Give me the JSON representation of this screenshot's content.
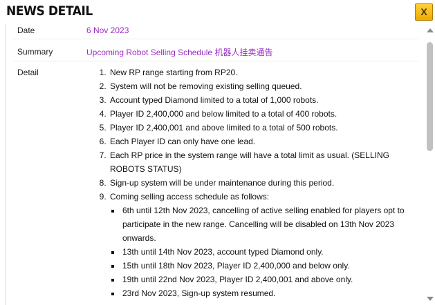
{
  "dialog": {
    "title": "NEWS DETAIL",
    "close_label": "X"
  },
  "fields": {
    "date_label": "Date",
    "date_value": "6 Nov 2023",
    "summary_label": "Summary",
    "summary_value": "Upcoming Robot Selling Schedule 机器人挂卖通告",
    "detail_label": "Detail"
  },
  "detail_items": [
    "New RP range starting from RP20.",
    "System will not be removing existing selling queued.",
    "Account typed Diamond limited to a total of 1,000 robots.",
    "Player ID 2,400,000 and below limited to a total of 400 robots.",
    "Player ID 2,400,001 and above limited to a total of 500 robots.",
    "Each Player ID can only have one lead.",
    "Each RP price in the system range will have a total limit as usual. (SELLING ROBOTS STATUS)",
    "Sign-up system will be under maintenance during this period.",
    "Coming selling access schedule as follows:"
  ],
  "schedule_items": [
    "6th until 12th Nov 2023, cancelling of active selling enabled for players opt to participate in the new range. Cancelling will be disabled on 13th Nov 2023 onwards.",
    "13th until 14th Nov 2023, account typed Diamond only.",
    "15th until 18th Nov 2023, Player ID 2,400,000 and below only.",
    "19th until 22nd Nov 2023, Player ID 2,400,001 and above only.",
    "23rd Nov 2023, Sign-up system resumed."
  ],
  "scrollbar": {
    "position": 0.0
  }
}
